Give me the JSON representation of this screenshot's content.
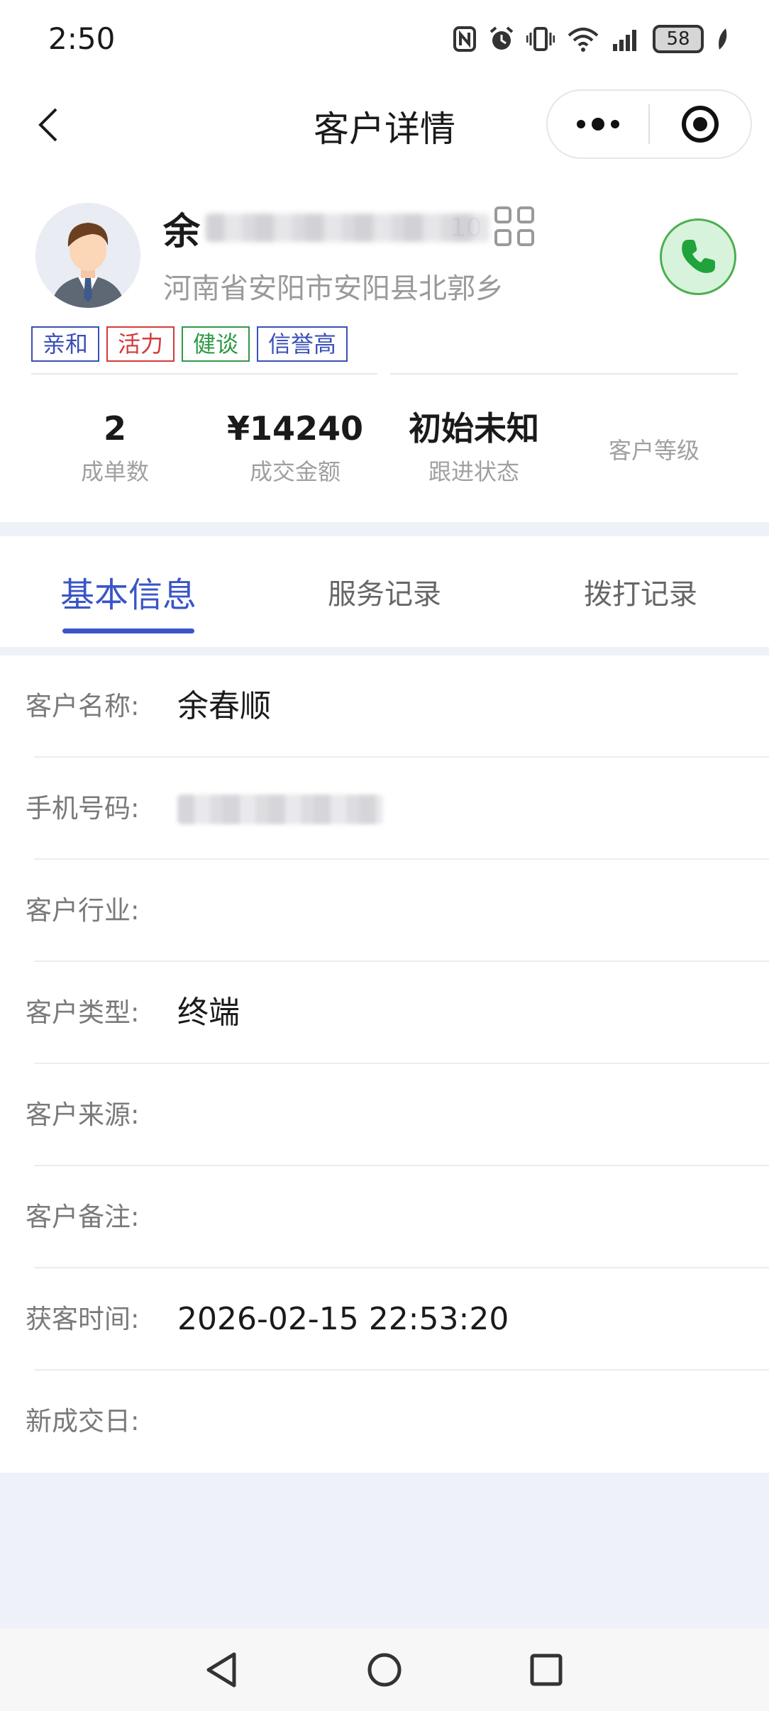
{
  "status_bar": {
    "time": "2:50",
    "battery": "58"
  },
  "nav": {
    "title": "客户详情"
  },
  "profile": {
    "name_visible": "余",
    "name_suffix": "10",
    "address": "河南省安阳市安阳县北郭乡",
    "tags": [
      {
        "label": "亲和",
        "color": "#3a4fb8"
      },
      {
        "label": "活力",
        "color": "#d43a3a"
      },
      {
        "label": "健谈",
        "color": "#2e9a46"
      },
      {
        "label": "信誉高",
        "color": "#3a4fb8"
      }
    ]
  },
  "stats": [
    {
      "value": "2",
      "label": "成单数"
    },
    {
      "value": "¥14240",
      "label": "成交金额"
    },
    {
      "value": "初始未知",
      "label": "跟进状态"
    },
    {
      "value": "",
      "label": "客户等级"
    }
  ],
  "tabs": [
    {
      "label": "基本信息",
      "active": true
    },
    {
      "label": "服务记录",
      "active": false
    },
    {
      "label": "拨打记录",
      "active": false
    }
  ],
  "info": [
    {
      "label": "客户名称:",
      "value": "余春顺"
    },
    {
      "label": "手机号码:",
      "value": "",
      "redacted": true
    },
    {
      "label": "客户行业:",
      "value": ""
    },
    {
      "label": "客户类型:",
      "value": "终端"
    },
    {
      "label": "客户来源:",
      "value": ""
    },
    {
      "label": "客户备注:",
      "value": ""
    },
    {
      "label": "获客时间:",
      "value": "2026-02-15 22:53:20"
    },
    {
      "label": "新成交日:",
      "value": ""
    }
  ],
  "colors": {
    "accent": "#3a55c8",
    "call_green": "#4caf50",
    "page_gap": "#eef1f8"
  }
}
